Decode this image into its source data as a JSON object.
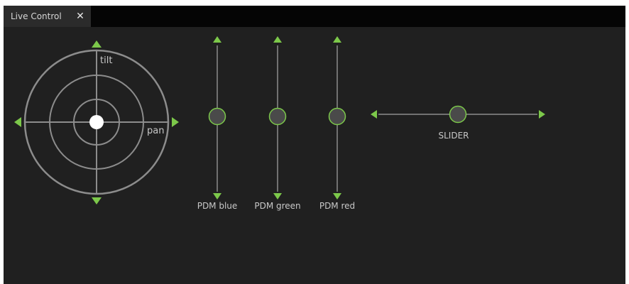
{
  "window": {
    "tab_label": "Live Control",
    "close_glyph": "✕"
  },
  "xy_pad": {
    "y_axis_label": "tilt",
    "x_axis_label": "pan",
    "pan_value": 0,
    "tilt_value": 0
  },
  "faders": [
    {
      "label": "PDM blue",
      "value": 0.5
    },
    {
      "label": "PDM green",
      "value": 0.5
    },
    {
      "label": "PDM red",
      "value": 0.5
    }
  ],
  "slider": {
    "label": "SLIDER",
    "value": 0.5
  },
  "colors": {
    "accent": "#7cc84a",
    "panel_bg": "#202020",
    "track": "#8c8c8c",
    "knob_fill": "#4a4a4a",
    "pad_dot": "#ffffff"
  }
}
